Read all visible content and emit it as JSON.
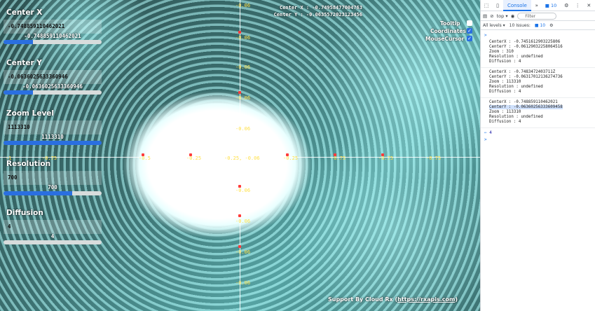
{
  "controls": {
    "center_x": {
      "title": "Center X",
      "input_value": "-0.748859110462021",
      "display_value": "-0.748859110462021",
      "slider_fraction": 0.3
    },
    "center_y": {
      "title": "Center Y",
      "input_value": "-0.0636025633360946",
      "display_value": "-0.0636025633360946",
      "slider_fraction": 0.3
    },
    "zoom": {
      "title": "Zoom Level",
      "input_value": "1113310",
      "display_value": "1113310",
      "slider_fraction": 1.0
    },
    "resolution": {
      "title": "Resolution",
      "input_value": "700",
      "display_value": "700",
      "slider_fraction": 0.7
    },
    "diffusion": {
      "title": "Diffusion",
      "input_value": "4",
      "display_value": "4",
      "slider_fraction": 0.0
    }
  },
  "info": {
    "center_x": "Center X : -0.74958477004763",
    "center_y": "Center Y : -0.0635572023123456"
  },
  "toggles": [
    {
      "label": "Tooltip",
      "checked": false
    },
    {
      "label": "Coordinates",
      "checked": true
    },
    {
      "label": "MouseCursor",
      "checked": true
    }
  ],
  "axis_labels": {
    "x": [
      "-1",
      "-0.75",
      "-0.5",
      "-0.25",
      "-0.25, -0.06",
      "-0.25",
      "-0.75",
      "-0.75",
      "-0.75"
    ],
    "y": [
      "-0.06",
      "-0.06",
      "-0.06",
      "-0.06",
      "-0.06",
      "-0.06",
      "-0.06",
      "-0.06",
      "-0.06"
    ]
  },
  "footer": {
    "text": "Support By Cloud Rx (",
    "link": "https://rxapis.com",
    "close": ")"
  },
  "devtools": {
    "tab_label": "Console",
    "more_tabs": "»",
    "issues_count": "10",
    "context": "top ▾",
    "filter_placeholder": "Filter",
    "levels": "All levels ▾",
    "issues_label": "10 Issues:",
    "issues_badge": "10",
    "logs": [
      [
        "CenterX : -0.7451612903225806",
        "CenterY : -0.06129032258064516",
        "Zoom : 310",
        "Resolution : undefined",
        "Diffusion : 4"
      ],
      [
        "CenterX : -0.7483472403711Z",
        "CenterY : -0.06317012136274736",
        "Zoom : 113310",
        "Resolution : undefined",
        "Diffusion : 4"
      ],
      [
        "CenterX : -0.748859110462021",
        "CenterY : -0.06360256333609458",
        "Zoom : 113310",
        "Resolution : undefined",
        "Diffusion : 4"
      ]
    ],
    "result": "4",
    "prompt": ">"
  }
}
